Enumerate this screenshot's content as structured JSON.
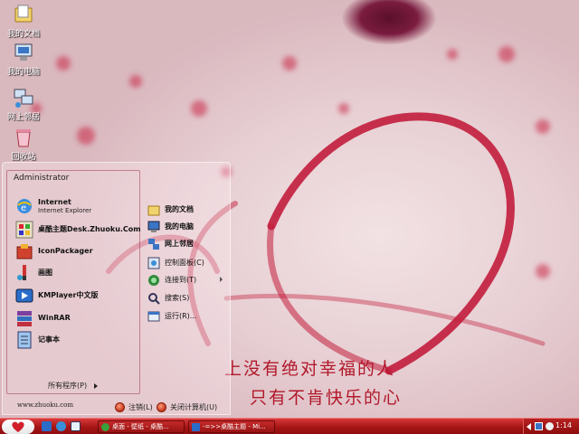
{
  "desktop": {
    "icons": [
      {
        "label": "我的文档",
        "icon": "my-documents-icon"
      },
      {
        "label": "我的电脑",
        "icon": "my-computer-icon"
      },
      {
        "label": "网上邻居",
        "icon": "network-places-icon"
      },
      {
        "label": "回收站",
        "icon": "recycle-bin-icon"
      }
    ],
    "wallpaper_text": [
      "上没有绝对幸福的人",
      "只有不肯快乐的心"
    ]
  },
  "start_menu": {
    "user": "Administrator",
    "pinned": [
      {
        "title": "Internet",
        "subtitle": "Internet Explorer",
        "icon": "internet-explorer-icon"
      },
      {
        "title": "桌酷主题Desk.Zhuoku.Com",
        "subtitle": "",
        "icon": "zhuoku-theme-icon"
      }
    ],
    "programs": [
      {
        "title": "IconPackager",
        "icon": "iconpackager-icon"
      },
      {
        "title": "画图",
        "icon": "paint-icon"
      },
      {
        "title": "KMPlayer中文版",
        "icon": "kmplayer-icon"
      },
      {
        "title": "WinRAR",
        "icon": "winrar-icon"
      },
      {
        "title": "记事本",
        "icon": "notepad-icon"
      }
    ],
    "all_programs": "所有程序(P)",
    "url": "www.zhuoku.com",
    "right_items": [
      {
        "label": "我的文档",
        "icon": "my-documents-icon",
        "bold": true
      },
      {
        "label": "我的电脑",
        "icon": "my-computer-icon",
        "bold": true
      },
      {
        "label": "网上邻居",
        "icon": "network-places-icon",
        "bold": true
      },
      {
        "label": "控制面板(C)",
        "icon": "control-panel-icon",
        "bold": false
      },
      {
        "label": "连接到(T)",
        "icon": "connect-to-icon",
        "bold": false
      },
      {
        "label": "搜索(S)",
        "icon": "search-icon",
        "bold": false
      },
      {
        "label": "运行(R)...",
        "icon": "run-icon",
        "bold": false
      }
    ],
    "logoff": "注销(L)",
    "shutdown": "关闭计算机(U)"
  },
  "taskbar": {
    "tasks": [
      {
        "label": "桌面 - 壁纸 - 桌酷...",
        "icon": "browser-icon"
      },
      {
        "label": "-=>>桌酷主题 - Mi...",
        "icon": "document-icon"
      }
    ],
    "clock": "1:14",
    "colors": {
      "taskbar": "#a51515",
      "wallpaper_text": "#b2182b"
    }
  }
}
